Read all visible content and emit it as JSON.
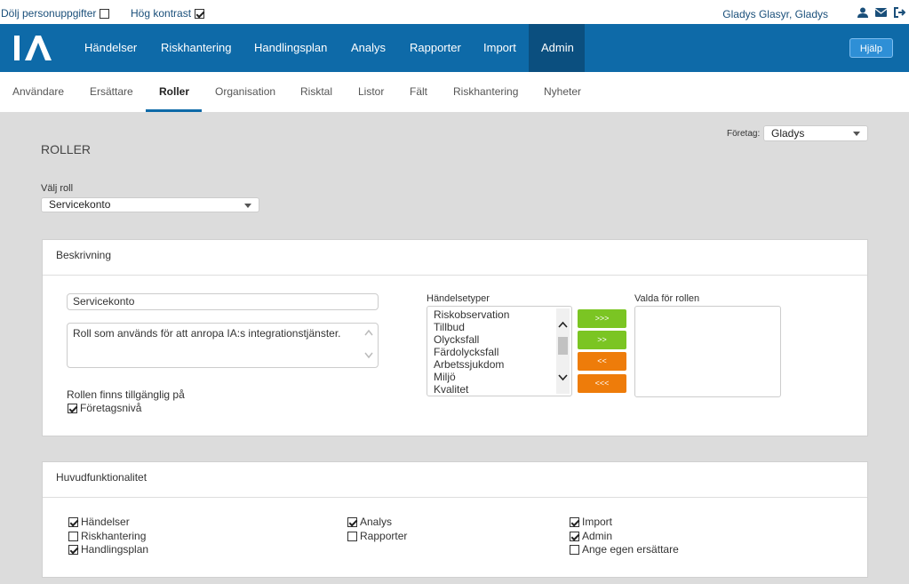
{
  "topbar": {
    "hide_personal": "Dölj personuppgifter",
    "high_contrast": "Hög kontrast",
    "user_name": "Gladys Glasyr, Gladys"
  },
  "nav": {
    "logo_text": "IA",
    "items": [
      "Händelser",
      "Riskhantering",
      "Handlingsplan",
      "Analys",
      "Rapporter",
      "Import",
      "Admin"
    ],
    "active": "Admin",
    "help": "Hjälp"
  },
  "subnav": {
    "items": [
      "Användare",
      "Ersättare",
      "Roller",
      "Organisation",
      "Risktal",
      "Listor",
      "Fält",
      "Riskhantering",
      "Nyheter"
    ],
    "active": "Roller"
  },
  "page": {
    "title": "ROLLER",
    "company_label": "Företag:",
    "company_value": "Gladys",
    "role_label": "Välj roll",
    "role_value": "Servicekonto"
  },
  "beskrivning": {
    "header": "Beskrivning",
    "name_value": "Servicekonto",
    "description_value": "Roll som används för att anropa IA:s integrationstjänster.",
    "availability_label": "Rollen finns tillgänglig på",
    "availability_option": "Företagsnivå",
    "event_types_label": "Händelsetyper",
    "event_types": [
      "Riskobservation",
      "Tillbud",
      "Olycksfall",
      "Färdolycksfall",
      "Arbetssjukdom",
      "Miljö",
      "Kvalitet"
    ],
    "selected_label": "Valda för rollen",
    "btn_add_all": ">>>",
    "btn_add": ">>",
    "btn_remove": "<<",
    "btn_remove_all": "<<<"
  },
  "huvud": {
    "header": "Huvudfunktionalitet",
    "col1": [
      {
        "label": "Händelser",
        "checked": true
      },
      {
        "label": "Riskhantering",
        "checked": false
      },
      {
        "label": "Handlingsplan",
        "checked": true
      }
    ],
    "col2": [
      {
        "label": "Analys",
        "checked": true
      },
      {
        "label": "Rapporter",
        "checked": false
      }
    ],
    "col3": [
      {
        "label": "Import",
        "checked": true
      },
      {
        "label": "Admin",
        "checked": true
      },
      {
        "label": "Ange egen ersättare",
        "checked": false
      }
    ]
  },
  "colors": {
    "nav_bg": "#0e6aa8",
    "nav_active": "#0b4f7f",
    "green": "#7bc523",
    "orange": "#ee7c0a"
  }
}
